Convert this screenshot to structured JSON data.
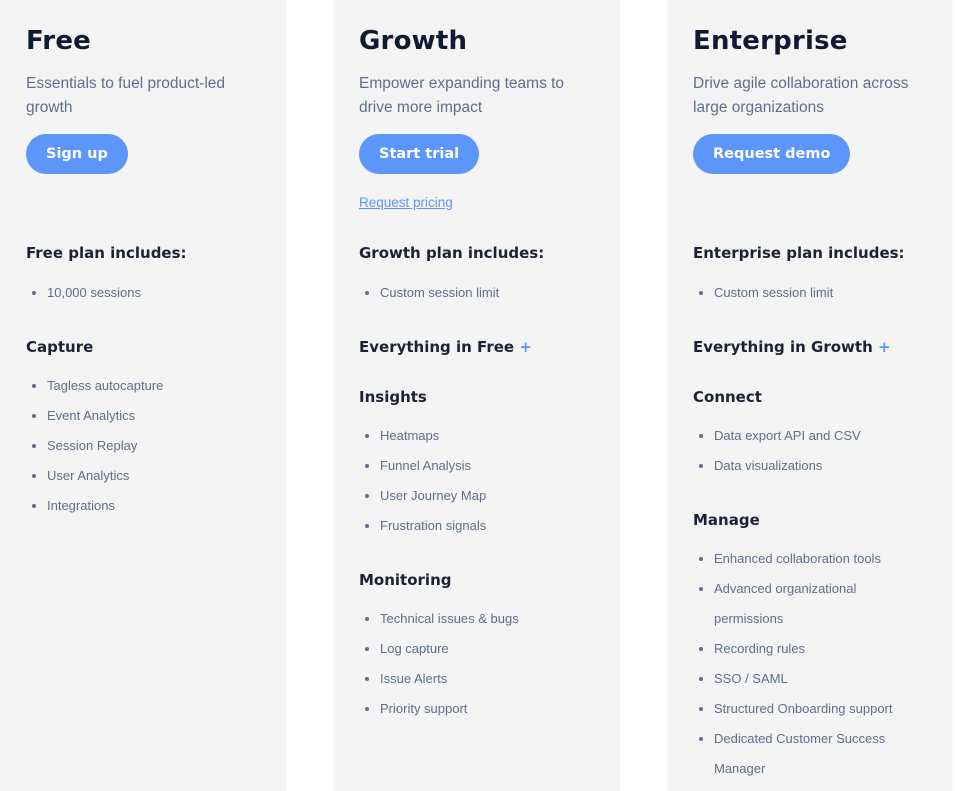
{
  "plans": [
    {
      "name": "Free",
      "description": "Essentials to fuel product-led growth",
      "cta_label": "Sign up",
      "includes_title": "Free plan includes:",
      "includes": [
        "10,000 sessions"
      ],
      "sections": [
        {
          "title": "Capture",
          "items": [
            "Tagless autocapture",
            "Event Analytics",
            "Session Replay",
            "User Analytics",
            "Integrations"
          ]
        }
      ]
    },
    {
      "name": "Growth",
      "description": "Empower expanding teams to drive more impact",
      "cta_label": "Start trial",
      "secondary_link": "Request pricing",
      "includes_title": "Growth plan includes:",
      "includes": [
        "Custom session limit"
      ],
      "everything_in": "Everything in Free",
      "plus_symbol": "+",
      "sections": [
        {
          "title": "Insights",
          "items": [
            "Heatmaps",
            "Funnel Analysis",
            "User Journey Map",
            "Frustration signals"
          ]
        },
        {
          "title": "Monitoring",
          "items": [
            "Technical issues & bugs",
            "Log capture",
            "Issue Alerts",
            "Priority support"
          ]
        }
      ]
    },
    {
      "name": "Enterprise",
      "description": "Drive agile collaboration across large organizations",
      "cta_label": "Request demo",
      "includes_title": "Enterprise plan includes:",
      "includes": [
        "Custom session limit"
      ],
      "everything_in": "Everything in Growth",
      "plus_symbol": "+",
      "sections": [
        {
          "title": "Connect",
          "items": [
            "Data export API and CSV",
            "Data visualizations"
          ]
        },
        {
          "title": "Manage",
          "items": [
            "Enhanced collaboration tools",
            "Advanced organizational permissions",
            "Recording rules",
            "SSO / SAML",
            "Structured Onboarding support",
            "Dedicated Customer Success Manager"
          ]
        }
      ]
    }
  ],
  "colors": {
    "accent": "#5c96fb",
    "card_background": "#f4f4f4",
    "heading": "#111a33",
    "body_text": "#5e6e8c"
  }
}
